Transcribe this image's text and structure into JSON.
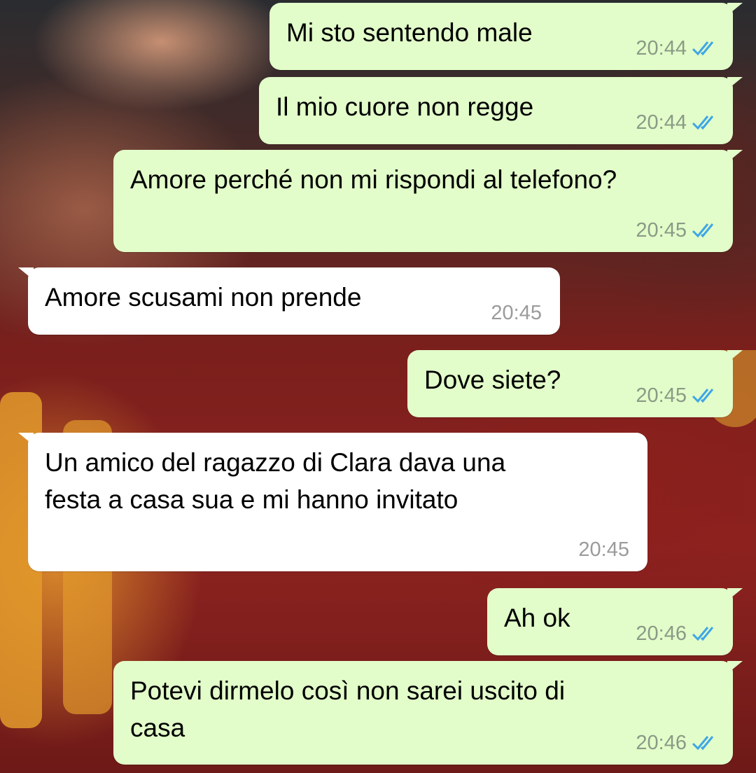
{
  "colors": {
    "outgoing_bubble": "#e2fdc9",
    "incoming_bubble": "#ffffff",
    "read_ticks": "#3fa6e6",
    "timestamp": "#8a9a87"
  },
  "messages": [
    {
      "direction": "out",
      "text": "Mi sto sentendo male",
      "time": "20:44",
      "status": "read-double-check-icon"
    },
    {
      "direction": "out",
      "text": "Il mio cuore non regge",
      "time": "20:44",
      "status": "read-double-check-icon"
    },
    {
      "direction": "out",
      "text": "Amore perché non mi rispondi al telefono?",
      "time": "20:45",
      "status": "read-double-check-icon"
    },
    {
      "direction": "in",
      "text": "Amore scusami non prende",
      "time": "20:45"
    },
    {
      "direction": "out",
      "text": "Dove siete?",
      "time": "20:45",
      "status": "read-double-check-icon"
    },
    {
      "direction": "in",
      "text": "Un amico del ragazzo di Clara dava una\nfesta a casa sua e mi hanno invitato",
      "time": "20:45"
    },
    {
      "direction": "out",
      "text": "Ah ok",
      "time": "20:46",
      "status": "read-double-check-icon"
    },
    {
      "direction": "out",
      "text": "Potevi dirmelo così non sarei uscito di\ncasa",
      "time": "20:46",
      "status": "read-double-check-icon"
    }
  ]
}
